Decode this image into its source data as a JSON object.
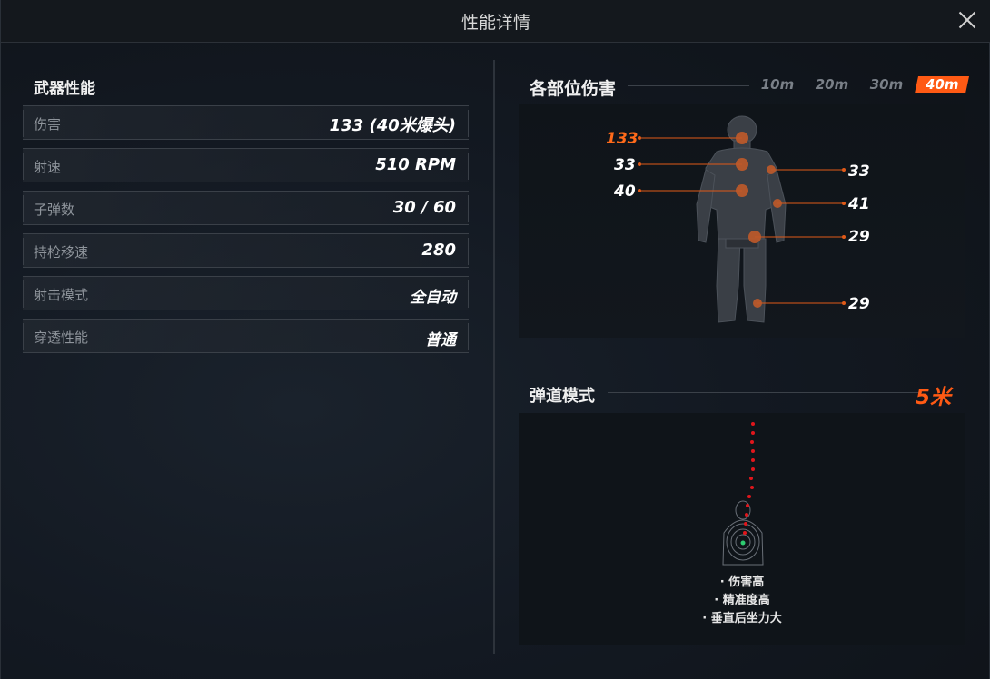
{
  "window": {
    "title": "性能详情",
    "close_label": "close"
  },
  "weapon_stats": {
    "title": "武器性能",
    "rows": [
      {
        "label": "伤害",
        "value": "133 (40米爆头)"
      },
      {
        "label": "射速",
        "value": "510 RPM"
      },
      {
        "label": "子弹数",
        "value": "30 / 60"
      },
      {
        "label": "持枪移速",
        "value": "280"
      },
      {
        "label": "射击模式",
        "value": "全自动"
      },
      {
        "label": "穿透性能",
        "value": "普通"
      }
    ]
  },
  "body_damage": {
    "title": "各部位伤害",
    "ranges": [
      "10m",
      "20m",
      "30m",
      "40m"
    ],
    "active_range": "40m",
    "values": {
      "head": "133",
      "chest_upper": "33",
      "chest_lower": "40",
      "arm_upper": "33",
      "arm_lower": "41",
      "stomach": "29",
      "leg": "29"
    },
    "accent_color": "#ff5a14"
  },
  "trajectory": {
    "title": "弹道模式",
    "distance": "5米",
    "traits": [
      "· 伤害高",
      "· 精准度高",
      "· 垂直后坐力大"
    ],
    "dot_color": "#e0161c"
  }
}
